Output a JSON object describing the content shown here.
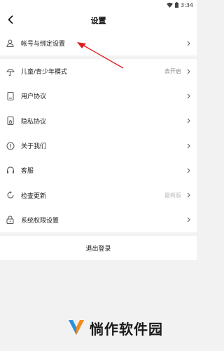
{
  "status_bar": {
    "time": "3:34"
  },
  "header": {
    "title": "设置"
  },
  "account_group": {
    "items": [
      {
        "label": "帐号与绑定设置",
        "value": ""
      }
    ]
  },
  "settings_group": {
    "items": [
      {
        "label": "儿童/青少年模式",
        "value": "去开启"
      },
      {
        "label": "用户协议",
        "value": ""
      },
      {
        "label": "隐私协议",
        "value": ""
      },
      {
        "label": "关于我们",
        "value": ""
      },
      {
        "label": "客服",
        "value": ""
      },
      {
        "label": "检查更新",
        "value": "最新版"
      },
      {
        "label": "系统权限设置",
        "value": ""
      }
    ]
  },
  "logout": {
    "label": "退出登录"
  },
  "watermark": {
    "text": "惝作软件园"
  },
  "colors": {
    "annotation_arrow": "#e02020",
    "watermark_blue": "#2b8fe0",
    "watermark_orange": "#f28c1e"
  }
}
